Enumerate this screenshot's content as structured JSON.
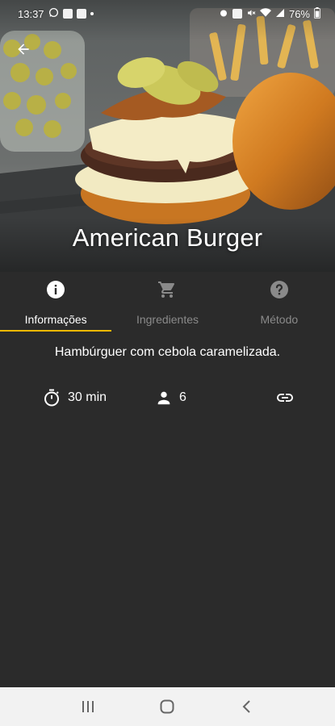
{
  "status_bar": {
    "time": "13:37",
    "battery": "76%",
    "icons": [
      "whatsapp-icon",
      "image-icon",
      "mail-icon",
      "alarm-icon",
      "nfc-icon",
      "mute-icon",
      "wifi-icon",
      "signal-icon",
      "battery-icon"
    ]
  },
  "recipe": {
    "title": "American Burger",
    "description": "Hambúrguer com cebola caramelizada.",
    "time": "30 min",
    "servings": "6"
  },
  "tabs": [
    {
      "label": "Informações",
      "icon": "info-icon",
      "active": true
    },
    {
      "label": "Ingredientes",
      "icon": "cart-icon",
      "active": false
    },
    {
      "label": "Método",
      "icon": "help-icon",
      "active": false
    }
  ],
  "colors": {
    "background": "#2b2b2b",
    "accent": "#f5b900",
    "inactive_tab": "#8a8a8a",
    "nav_bar": "#f2f2f2"
  }
}
